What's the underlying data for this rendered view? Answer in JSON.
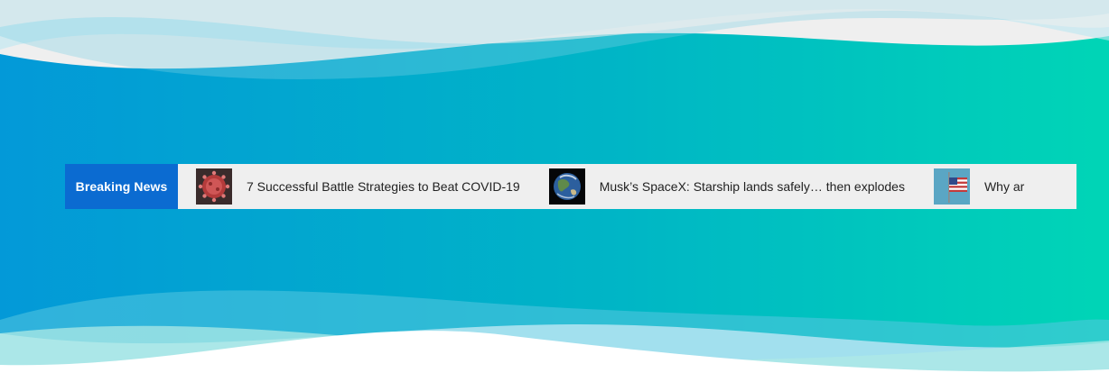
{
  "ticker": {
    "label": "Breaking News",
    "items": [
      {
        "text": "7 Successful Battle Strategies to Beat COVID-19",
        "thumb_icon": "virus-icon"
      },
      {
        "text": "Musk’s SpaceX: Starship lands safely… then explodes",
        "thumb_icon": "earth-icon"
      },
      {
        "text": "Why ar",
        "thumb_icon": "flag-icon"
      }
    ]
  },
  "colors": {
    "gradient_start": "#0399d8",
    "gradient_end": "#00d5b6",
    "label_bg": "#0b6bd1",
    "ticker_bg": "#efefef"
  }
}
